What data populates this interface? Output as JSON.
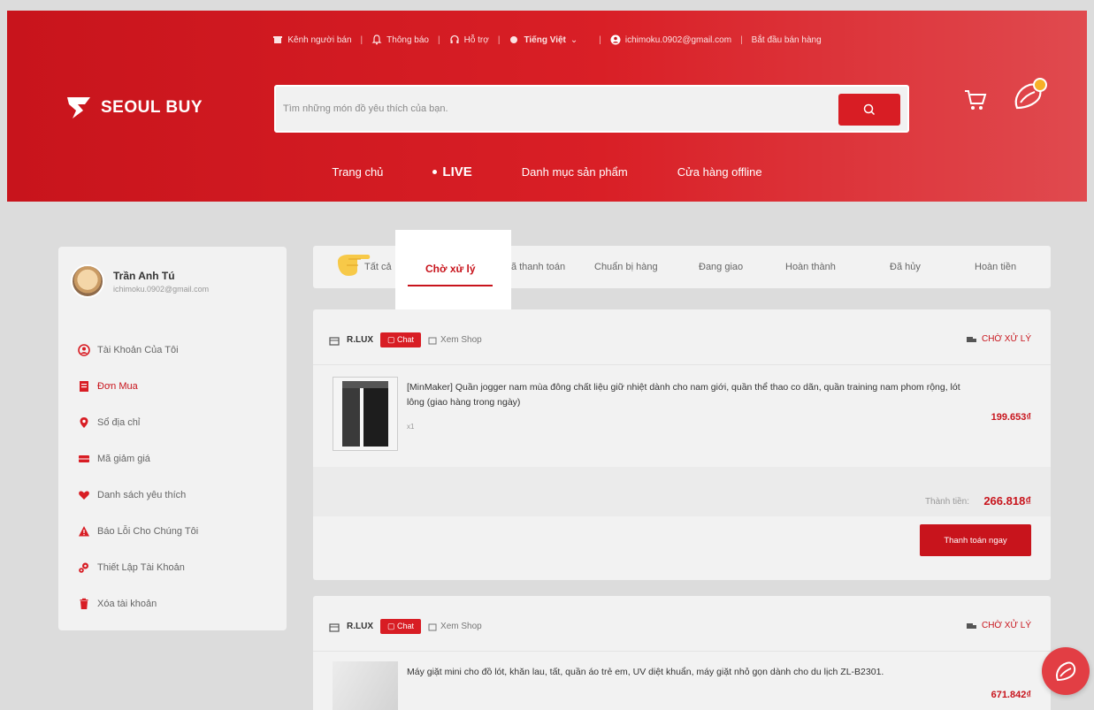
{
  "topbar": {
    "seller_channel": "Kênh người bán",
    "notifications": "Thông báo",
    "support": "Hỗ trợ",
    "language": "Tiếng Việt",
    "email": "ichimoku.0902@gmail.com",
    "start_selling": "Bắt đầu bán hàng"
  },
  "header": {
    "logo_text": "SEOUL BUY",
    "search_placeholder": "Tìm những món đồ yêu thích của bạn."
  },
  "nav": {
    "items": [
      "Trang chủ",
      "LIVE",
      "Danh mục sản phẩm",
      "Cửa hàng offline"
    ]
  },
  "sidebar": {
    "profile": {
      "name": "Trần Anh Tú",
      "email": "ichimoku.0902@gmail.com"
    },
    "items": [
      {
        "label": "Tài Khoản Của Tôi",
        "icon": "user-icon"
      },
      {
        "label": "Đơn Mua",
        "icon": "order-icon"
      },
      {
        "label": "Sổ địa chỉ",
        "icon": "location-icon"
      },
      {
        "label": "Mã giảm giá",
        "icon": "voucher-icon"
      },
      {
        "label": "Danh sách yêu thích",
        "icon": "heart-icon"
      },
      {
        "label": "Báo Lỗi Cho Chúng Tôi",
        "icon": "warning-icon"
      },
      {
        "label": "Thiết Lập Tài Khoản",
        "icon": "settings-icon"
      },
      {
        "label": "Xóa tài khoản",
        "icon": "trash-icon"
      }
    ]
  },
  "tabs": {
    "items": [
      "Tất cả",
      "Chờ xử lý",
      "Đã thanh toán",
      "Chuẩn bị hàng",
      "Đang giao",
      "Hoàn thành",
      "Đã hủy",
      "Hoàn tiền"
    ],
    "active": "Chờ xử lý"
  },
  "orders": [
    {
      "shop": "R.LUX",
      "chat_label": "Chat",
      "view_shop_label": "Xem Shop",
      "status": "CHỜ XỬ LÝ",
      "product_title": "[MinMaker] Quần jogger nam mùa đông chất liệu giữ nhiệt dành cho nam giới, quần thể thao co dãn, quần training nam phom rộng, lót lông (giao hàng trong ngày)",
      "quantity": "x1",
      "price": "199.653₫",
      "total_label": "Thành tiền:",
      "total": "266.818₫",
      "pay_label": "Thanh toán ngay"
    },
    {
      "shop": "R.LUX",
      "chat_label": "Chat",
      "view_shop_label": "Xem Shop",
      "status": "CHỜ XỬ LÝ",
      "product_title": "Máy giặt mini cho đồ lót, khăn lau, tất, quần áo trẻ em, UV diệt khuẩn, máy giặt nhỏ gọn dành cho du lịch ZL-B2301.",
      "price": "671.842₫"
    }
  ],
  "colors": {
    "brand": "#d81d24",
    "accent_yellow": "#f7b027"
  }
}
